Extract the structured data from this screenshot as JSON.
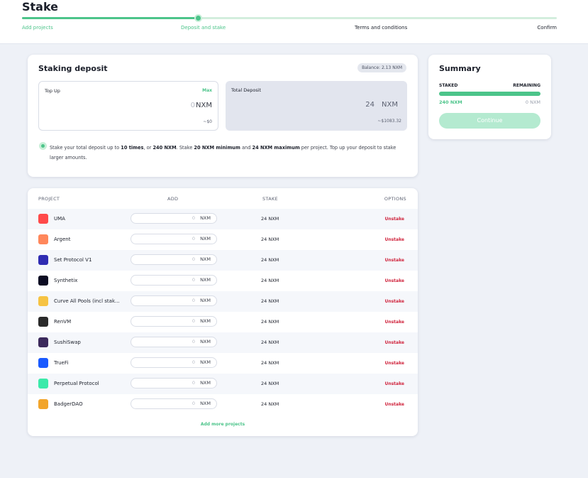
{
  "header": {
    "title": "Stake",
    "steps": [
      {
        "label": "Add projects"
      },
      {
        "label": "Deposit and stake"
      },
      {
        "label": "Terms and conditions"
      },
      {
        "label": "Confirm"
      }
    ]
  },
  "deposit": {
    "title": "Staking deposit",
    "balance": "Balance: 2.13 NXM",
    "topup": {
      "label": "Top Up",
      "max": "Max",
      "value": "0",
      "unit": "NXM",
      "usd": "~$0"
    },
    "total": {
      "label": "Total Deposit",
      "value": "24",
      "unit": "NXM",
      "usd": "~$1083.32"
    },
    "info": {
      "p1": "Stake your total deposit up to ",
      "b1": "10 times",
      "p2": ", or ",
      "b2": "240 NXM",
      "p3": ". Stake ",
      "b3": "20 NXM minimum",
      "p4": " and ",
      "b4": "24 NXM maximum",
      "p5": " per project. Top up your deposit to stake larger amounts."
    }
  },
  "summary": {
    "title": "Summary",
    "staked_label": "STAKED",
    "remaining_label": "REMAINING",
    "staked_value": "240 NXM",
    "remaining_value": "0 NXM",
    "staked_fraction": 1.0,
    "continue": "Continue"
  },
  "projects": {
    "columns": {
      "project": "PROJECT",
      "add": "ADD",
      "stake": "STAKE",
      "options": "OPTIONS"
    },
    "rows": [
      {
        "name": "UMA",
        "add": "0",
        "unit": "NXM",
        "stake": "24 NXM",
        "action": "Unstake",
        "logo_color": "#ff4a4a",
        "icon": "uma-logo"
      },
      {
        "name": "Argent",
        "add": "0",
        "unit": "NXM",
        "stake": "24 NXM",
        "action": "Unstake",
        "logo_color": "#ff875b",
        "icon": "argent-logo"
      },
      {
        "name": "Set Protocol V1",
        "add": "0",
        "unit": "NXM",
        "stake": "24 NXM",
        "action": "Unstake",
        "logo_color": "#2f2cb2",
        "icon": "set-protocol-logo"
      },
      {
        "name": "Synthetix",
        "add": "0",
        "unit": "NXM",
        "stake": "24 NXM",
        "action": "Unstake",
        "logo_color": "#0b0b22",
        "icon": "synthetix-logo"
      },
      {
        "name": "Curve All Pools (incl stak...",
        "add": "0",
        "unit": "NXM",
        "stake": "24 NXM",
        "action": "Unstake",
        "logo_color": "#f6c343",
        "icon": "curve-logo"
      },
      {
        "name": "RenVM",
        "add": "0",
        "unit": "NXM",
        "stake": "24 NXM",
        "action": "Unstake",
        "logo_color": "#2a2a2a",
        "icon": "renvm-logo"
      },
      {
        "name": "SushiSwap",
        "add": "0",
        "unit": "NXM",
        "stake": "24 NXM",
        "action": "Unstake",
        "logo_color": "#3c2a5c",
        "icon": "sushiswap-logo"
      },
      {
        "name": "TrueFi",
        "add": "0",
        "unit": "NXM",
        "stake": "24 NXM",
        "action": "Unstake",
        "logo_color": "#1a5aff",
        "icon": "truefi-logo"
      },
      {
        "name": "Perpetual Protocol",
        "add": "0",
        "unit": "NXM",
        "stake": "24 NXM",
        "action": "Unstake",
        "logo_color": "#3ceaaa",
        "icon": "perpetual-logo"
      },
      {
        "name": "BadgerDAO",
        "add": "0",
        "unit": "NXM",
        "stake": "24 NXM",
        "action": "Unstake",
        "logo_color": "#f2a52b",
        "icon": "badger-logo"
      }
    ],
    "add_more": "Add more projects"
  },
  "colors": {
    "accent": "#4cc48a",
    "danger": "#d0243d",
    "background": "#eef1f7"
  }
}
